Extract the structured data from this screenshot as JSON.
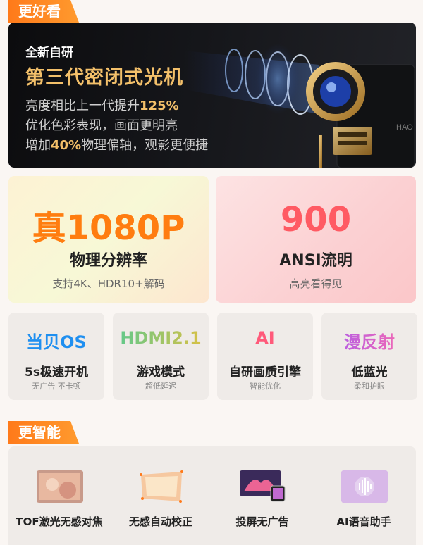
{
  "section1": {
    "label": "更好看"
  },
  "hero": {
    "eyebrow": "全新自研",
    "title": "第三代密闭式光机",
    "line1_prefix": "亮度相比上一代提升",
    "line1_highlight": "125%",
    "line2": "优化色彩表现，画面更明亮",
    "line3_prefix": "增加",
    "line3_highlight": "40%",
    "line3_suffix": "物理偏轴，观影更便捷",
    "brand_mark": "HAO"
  },
  "big_cards": [
    {
      "value": "真1080P",
      "label": "物理分辨率",
      "sub": "支持4K、HDR10+解码",
      "color": "#ff7d10"
    },
    {
      "value": "900",
      "label": "ANSI流明",
      "sub": "高亮看得见",
      "color": "#ff5a63"
    }
  ],
  "small_cards": [
    {
      "logo": "当贝OS",
      "label": "5s极速开机",
      "sub": "无广告 不卡顿"
    },
    {
      "logo": "HDMI2.1",
      "label": "游戏模式",
      "sub": "超低延迟"
    },
    {
      "logo": "AI",
      "label": "自研画质引擎",
      "sub": "智能优化"
    },
    {
      "logo": "漫反射",
      "label": "低蓝光",
      "sub": "柔和护眼"
    }
  ],
  "section2": {
    "label": "更智能"
  },
  "features": [
    {
      "label": "TOF激光无感对焦",
      "icon": "tof-focus-icon"
    },
    {
      "label": "无感自动校正",
      "icon": "auto-keystone-icon"
    },
    {
      "label": "投屏无广告",
      "icon": "screen-mirror-icon"
    },
    {
      "label": "AI语音助手",
      "icon": "voice-assistant-icon"
    }
  ]
}
